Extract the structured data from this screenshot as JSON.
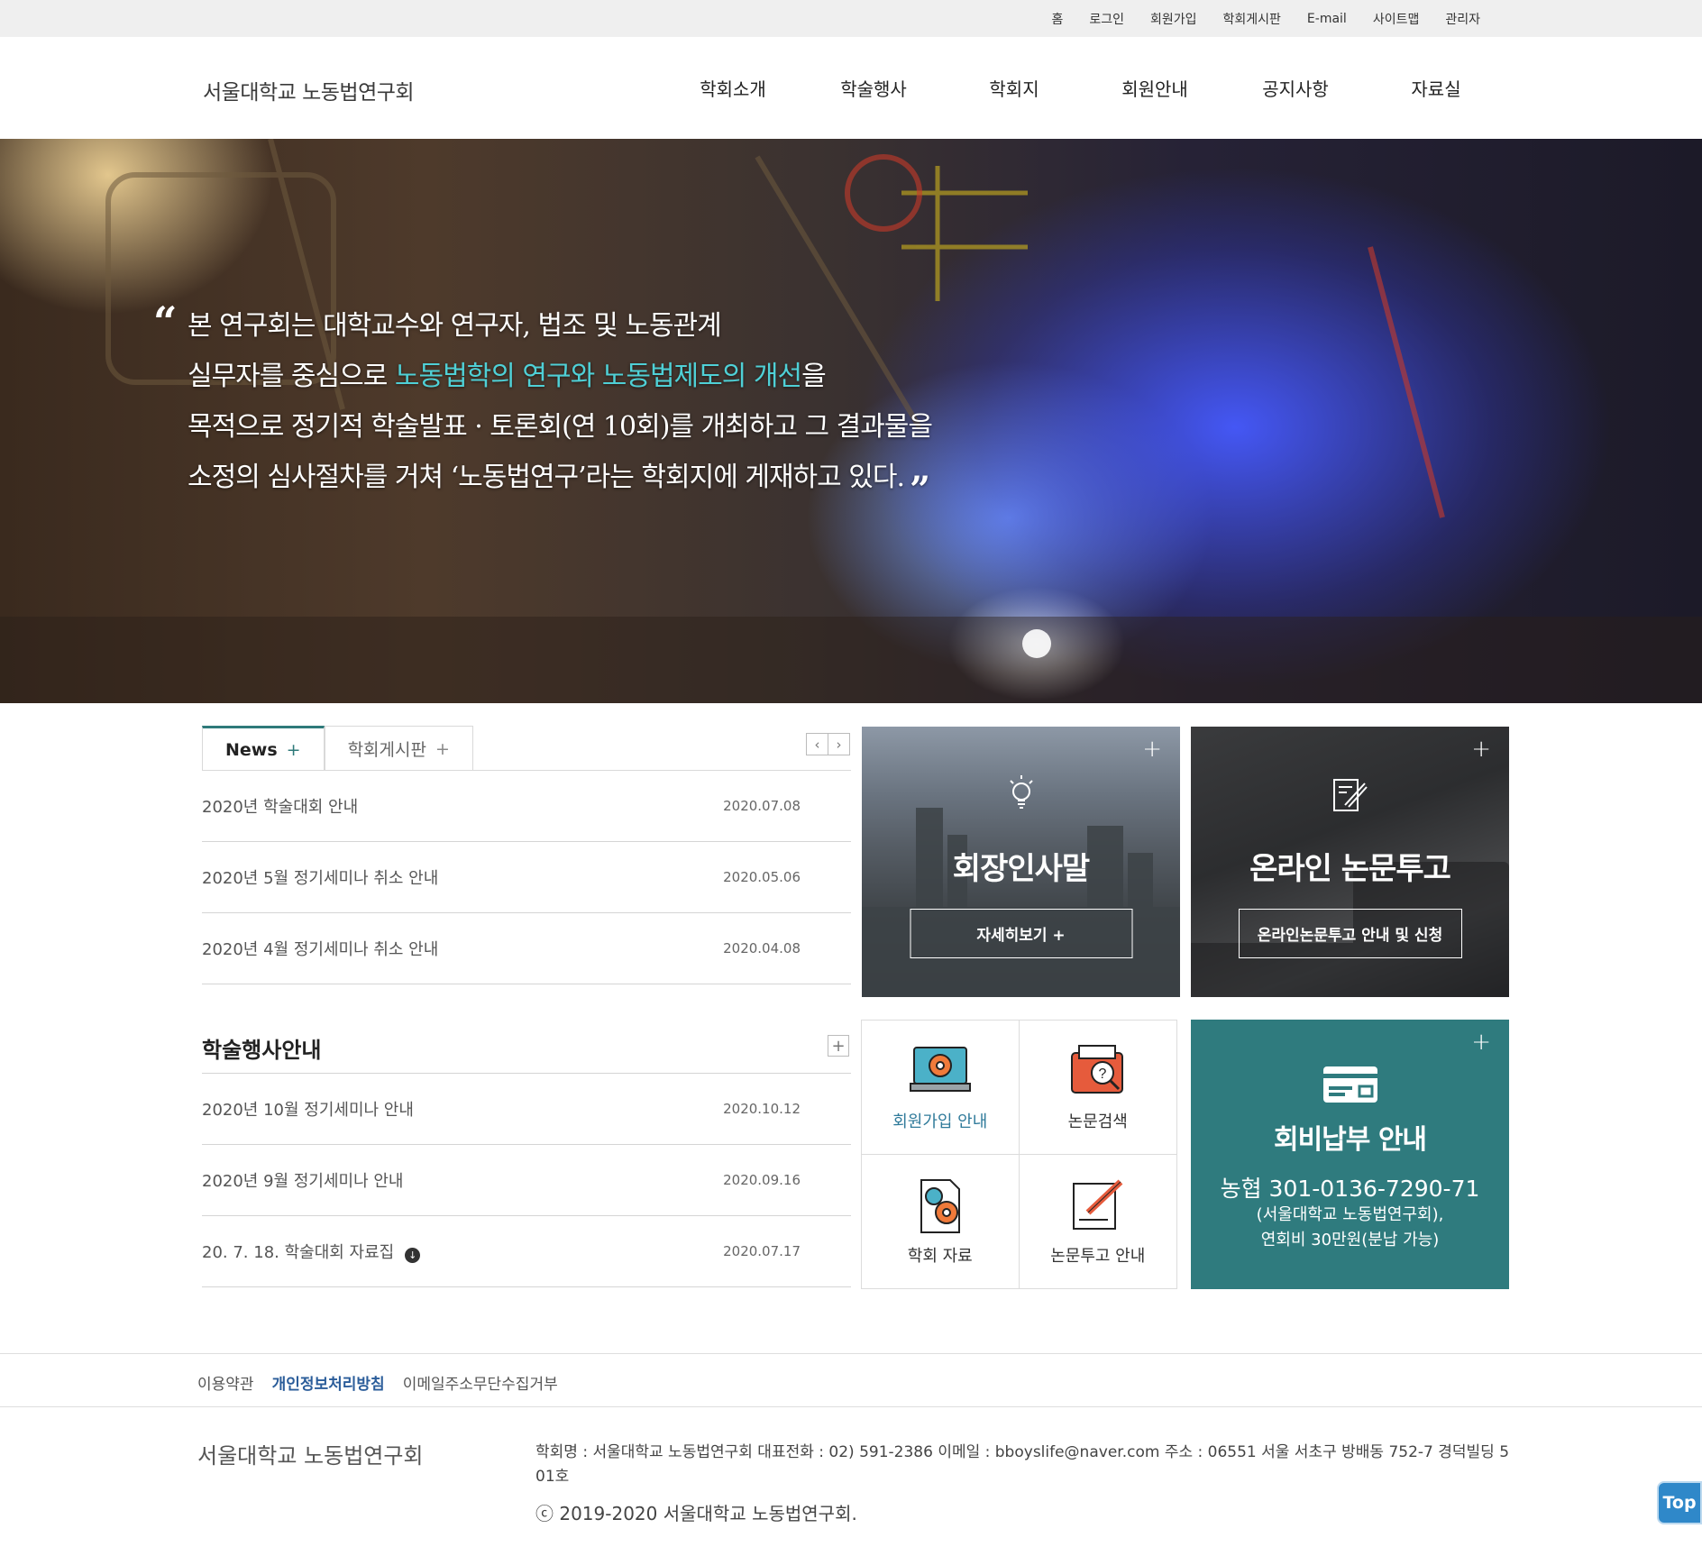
{
  "topbar": {
    "links": [
      "홈",
      "로그인",
      "회원가입",
      "학회게시판",
      "E-mail",
      "사이트맵",
      "관리자"
    ]
  },
  "header": {
    "logo": "서울대학교 노동법연구회",
    "nav": [
      "학회소개",
      "학술행사",
      "학회지",
      "회원안내",
      "공지사항",
      "자료실"
    ]
  },
  "hero": {
    "line1": "본 연구회는 대학교수와 연구자, 법조 및 노동관계",
    "line2_pre": "실무자를 중심으로 ",
    "line2_hl": "노동법학의 연구와 노동법제도의 개선",
    "line2_post": "을",
    "line3": "목적으로 정기적 학술발표 · 토론회(연 10회)를 개최하고 그 결과물을",
    "line4": "소정의 심사절차를 거쳐 ‘노동법연구’라는 학회지에 게재하고 있다.",
    "quote_open": "“",
    "quote_close": "”"
  },
  "news": {
    "tabs": [
      "News",
      "학회게시판"
    ],
    "tab_plus": "+",
    "items": [
      {
        "title": "2020년 학술대회 안내",
        "date": "2020.07.08"
      },
      {
        "title": "2020년 5월 정기세미나 취소 안내",
        "date": "2020.05.06"
      },
      {
        "title": "2020년 4월 정기세미나 취소 안내",
        "date": "2020.04.08"
      }
    ]
  },
  "events": {
    "title": "학술행사안내",
    "more": "+",
    "items": [
      {
        "title": "2020년 10월 정기세미나 안내",
        "date": "2020.10.12"
      },
      {
        "title": "2020년 9월 정기세미나 안내",
        "date": "2020.09.16"
      },
      {
        "title": "20. 7. 18. 학술대회 자료집",
        "date": "2020.07.17"
      }
    ]
  },
  "cards": {
    "greeting": {
      "title": "회장인사말",
      "button": "자세히보기 +",
      "icon": "lightbulb-icon"
    },
    "online": {
      "title": "온라인 논문투고",
      "button": "온라인논문투고 안내 및 신청",
      "icon": "document-pen-icon"
    },
    "fee": {
      "title": "회비납부 안내",
      "account": "농협 301-0136-7290-71",
      "note1": "(서울대학교 노동법연구회),",
      "note2": "연회비 30만원(분납 가능)",
      "icon": "card-icon"
    },
    "plus": "+"
  },
  "quick": [
    {
      "label": "회원가입 안내",
      "icon": "laptop-gear-icon"
    },
    {
      "label": "논문검색",
      "icon": "wallet-search-icon"
    },
    {
      "label": "학회 자료",
      "icon": "gear-document-icon"
    },
    {
      "label": "논문투고 안내",
      "icon": "writing-icon"
    }
  ],
  "footer": {
    "links": [
      "이용약관",
      "개인정보처리방침",
      "이메일주소무단수집거부"
    ],
    "logo": "서울대학교 노동법연구회",
    "info": "학회명 : 서울대학교 노동법연구회    대표전화 : 02) 591-2386    이메일 : bboyslife@naver.com    주소 : 06551 서울 서초구 방배동 752-7 경덕빌딩 501호",
    "copyright": "ⓒ 2019-2020 서울대학교 노동법연구회.",
    "top": "Top"
  },
  "colors": {
    "accent": "#2f7b7e",
    "highlight": "#4fd0d6",
    "link_strong": "#2b5d9a",
    "top_button": "#2f88c9"
  }
}
